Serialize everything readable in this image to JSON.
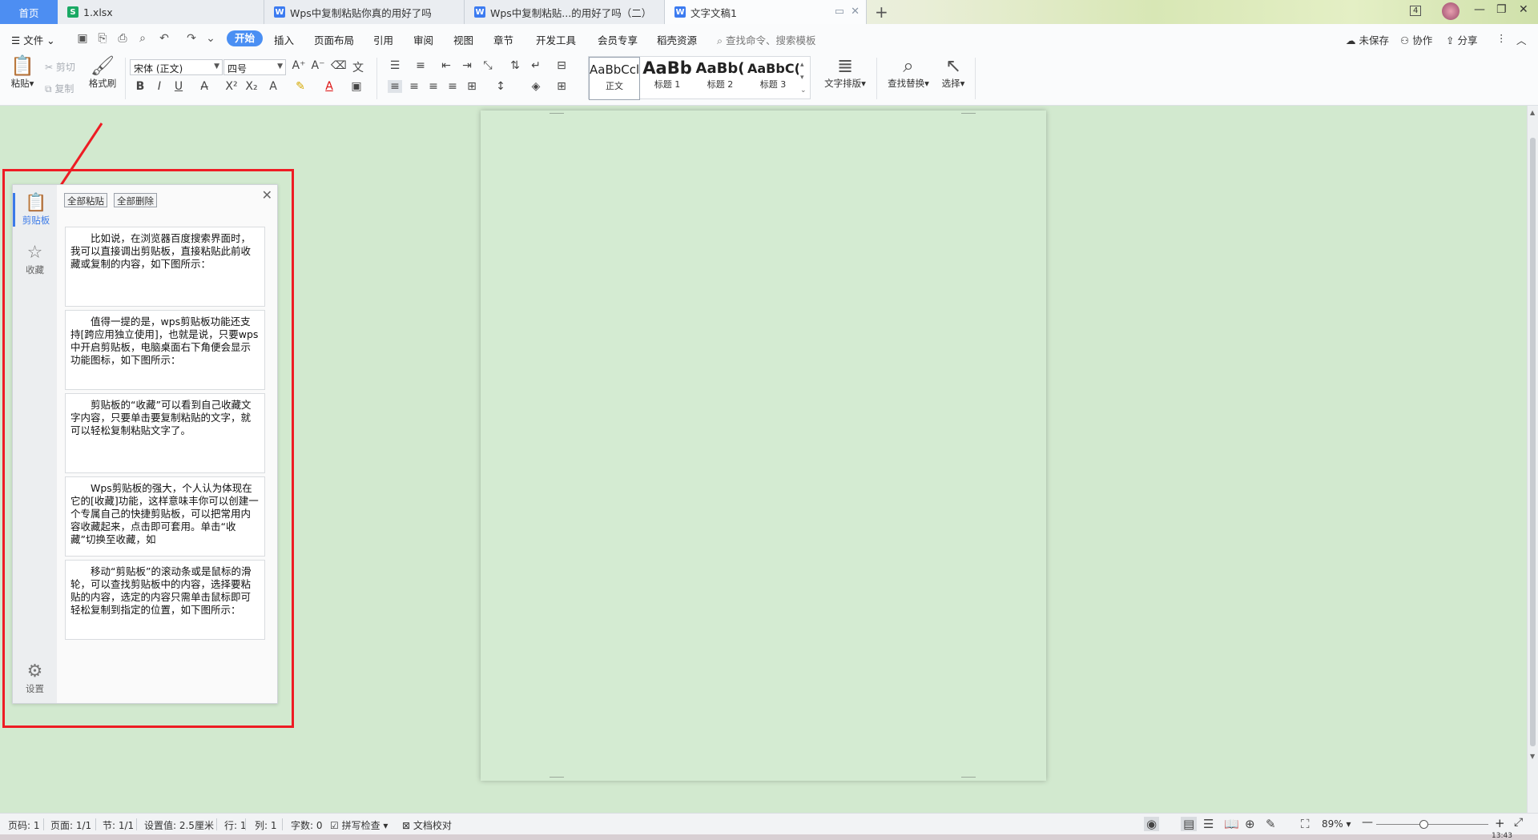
{
  "tabs": {
    "home": "首页",
    "t1": "1.xlsx",
    "t2": "Wps中复制粘贴你真的用好了吗",
    "t3": "Wps中复制粘贴...的用好了吗（二）",
    "t4": "文字文稿1",
    "badge": "4"
  },
  "menu": {
    "file": "文件",
    "start": "开始",
    "insert": "插入",
    "layout": "页面布局",
    "reference": "引用",
    "review": "审阅",
    "view": "视图",
    "chapter": "章节",
    "dev": "开发工具",
    "vip": "会员专享",
    "shell": "稻壳资源",
    "search": "查找命令、搜索模板",
    "unsaved": "未保存",
    "collab": "协作",
    "share": "分享"
  },
  "ribbon": {
    "paste": "粘贴",
    "cut": "剪切",
    "copy": "复制",
    "format_painter": "格式刷",
    "font_name": "宋体 (正文)",
    "font_size": "四号",
    "styles": [
      {
        "sample": "AaBbCcl",
        "name": "正文"
      },
      {
        "sample": "AaBb",
        "name": "标题 1"
      },
      {
        "sample": "AaBb(",
        "name": "标题 2"
      },
      {
        "sample": "AaBbC(",
        "name": "标题 3"
      }
    ],
    "text_layout": "文字排版",
    "find_replace": "查找替换",
    "select": "选择"
  },
  "clipboard": {
    "paste_all": "全部粘贴",
    "delete_all": "全部删除",
    "side_clipboard": "剪贴板",
    "side_favorites": "收藏",
    "side_settings": "设置",
    "items": [
      "比如说，在浏览器百度搜索界面时，我可以直接调出剪贴板，直接粘贴此前收藏或复制的内容，如下图所示：",
      "值得一提的是，wps剪贴板功能还支持[跨应用独立使用]，也就是说，只要wps中开启剪贴板，电脑桌面右下角便会显示功能图标，如下图所示：",
      "剪贴板的“收藏”可以看到自己收藏文字内容，只要单击要复制粘贴的文字，就可以轻松复制粘贴文字了。",
      "Wps剪贴板的强大，个人认为体现在它的[收藏]功能，这样意味丰你可以创建一个专属自己的快捷剪贴板，可以把常用内容收藏起来，点击即可套用。单击“收藏”切换至收藏，如",
      "移动“剪贴板”的滚动条或是鼠标的滑轮，可以查找剪贴板中的内容，选择要粘贴的内容，选定的内容只需单击鼠标即可轻松复制到指定的位置，如下图所示："
    ]
  },
  "status": {
    "page_code": "页码: 1",
    "pages": "页面: 1/1",
    "section": "节: 1/1",
    "setting": "设置值: 2.5厘米",
    "row": "行: 1",
    "col": "列: 1",
    "words": "字数: 0",
    "spell": "拼写检查",
    "proof": "文档校对",
    "zoom": "89%",
    "time": "13:43"
  },
  "colors": {
    "accent": "#4a8ff3",
    "annotation": "#ee1c24",
    "page_bg": "#d2e9cf"
  }
}
